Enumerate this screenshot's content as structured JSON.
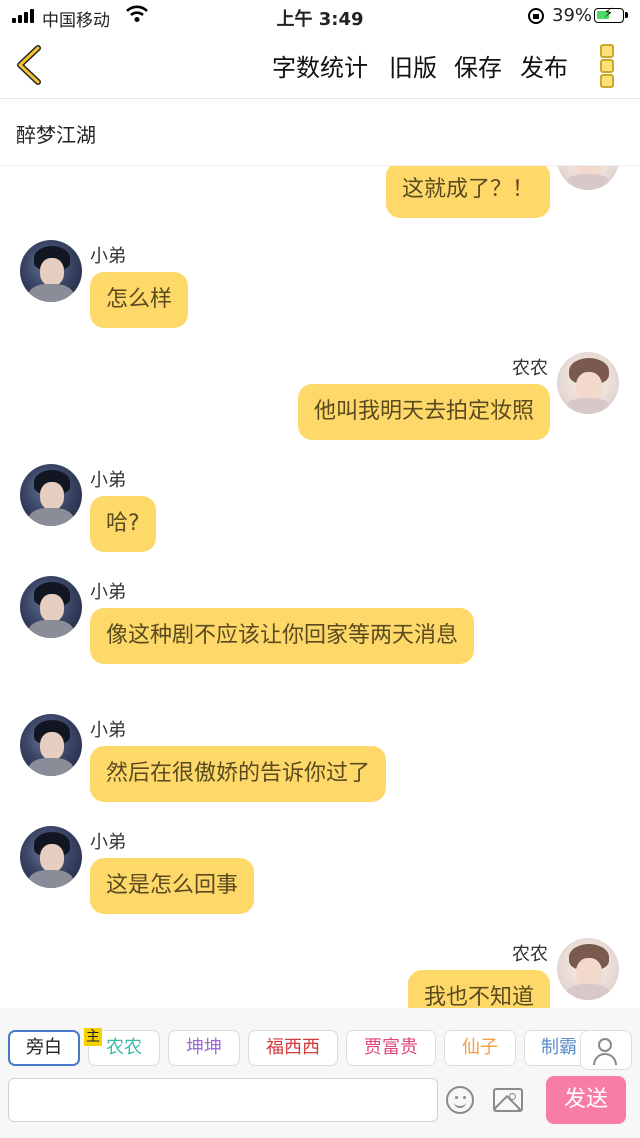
{
  "status_bar": {
    "carrier": "中国移动",
    "time": "上午 3:49",
    "battery": "39%",
    "battery_level": 0.39,
    "icons": [
      "signal-icon",
      "wifi-icon",
      "orientation-lock-icon",
      "battery-charging-icon"
    ]
  },
  "header": {
    "back_icon": "chevron-left-icon",
    "word_count": "字数统计",
    "old_version": "旧版",
    "save": "保存",
    "publish": "发布",
    "more_icon": "vertical-dots-icon",
    "accent_color": "#fed96a"
  },
  "document": {
    "title": "醉梦江湖"
  },
  "messages": [
    {
      "side": "right",
      "name": "",
      "text": "这就成了？！",
      "avatar": "avatar-nongnong"
    },
    {
      "side": "left",
      "name": "小弟",
      "text": "怎么样",
      "avatar": "avatar-xiaodi"
    },
    {
      "side": "right",
      "name": "农农",
      "text": "他叫我明天去拍定妆照",
      "avatar": "avatar-nongnong"
    },
    {
      "side": "left",
      "name": "小弟",
      "text": "哈?",
      "avatar": "avatar-xiaodi"
    },
    {
      "side": "left",
      "name": "小弟",
      "text": "像这种剧不应该让你回家等两天消息",
      "avatar": "avatar-xiaodi"
    },
    {
      "side": "left",
      "name": "小弟",
      "text": "然后在很傲娇的告诉你过了",
      "avatar": "avatar-xiaodi"
    },
    {
      "side": "left",
      "name": "小弟",
      "text": "这是怎么回事",
      "avatar": "avatar-xiaodi"
    },
    {
      "side": "right",
      "name": "农农",
      "text": "我也不知道",
      "avatar": "avatar-nongnong"
    }
  ],
  "roles": {
    "items": [
      {
        "label": "旁白",
        "color": "#222222",
        "selected": true
      },
      {
        "label": "农农",
        "color": "#3cb8a8",
        "main": true
      },
      {
        "label": "坤坤",
        "color": "#a06ad6"
      },
      {
        "label": "福西西",
        "color": "#d23b3b"
      },
      {
        "label": "贾富贵",
        "color": "#e0457b"
      },
      {
        "label": "仙子",
        "color": "#f2a040"
      },
      {
        "label": "制霸",
        "color": "#5a8cc8"
      }
    ],
    "main_badge": "主",
    "add_role_icon": "person-icon"
  },
  "composer": {
    "input_value": "",
    "input_placeholder": "",
    "emoji_icon": "emoji-icon",
    "image_icon": "image-icon",
    "send": "发送",
    "send_color": "#f77ca8"
  }
}
